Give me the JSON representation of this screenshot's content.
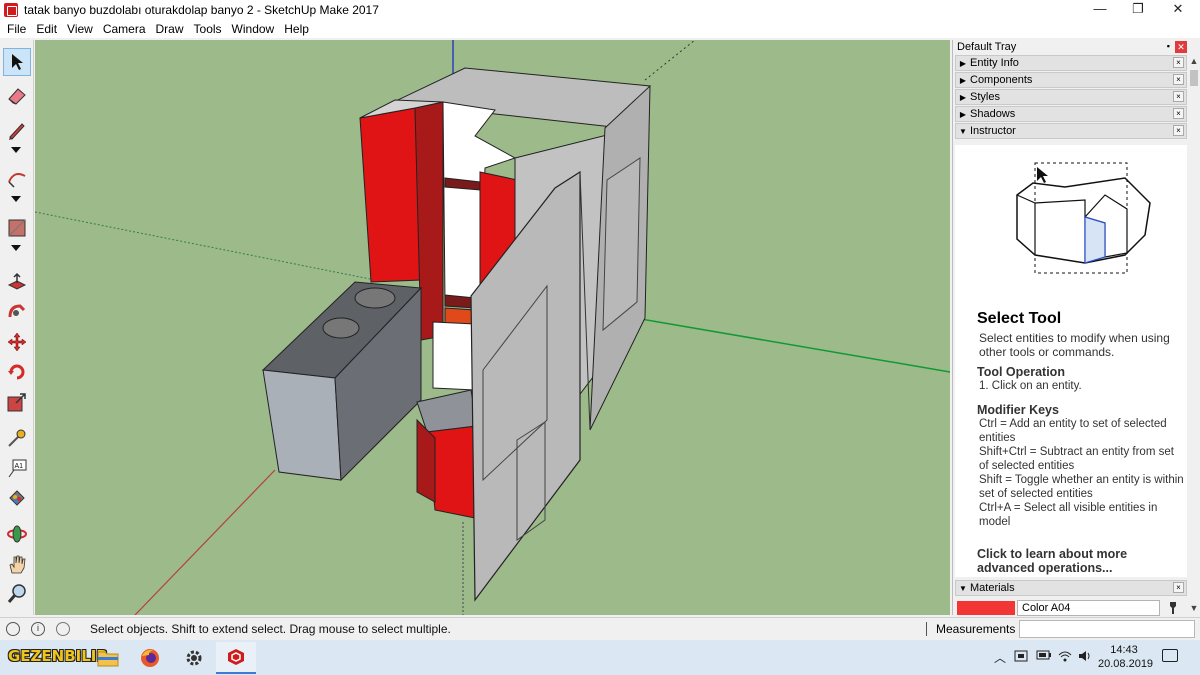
{
  "window": {
    "title": "tatak banyo buzdolabı oturakdolap banyo 2 - SketchUp Make 2017",
    "minimize": "—",
    "maximize": "❐",
    "close": "✕"
  },
  "menu": {
    "items": [
      "File",
      "Edit",
      "View",
      "Camera",
      "Draw",
      "Tools",
      "Window",
      "Help"
    ]
  },
  "toolbar": {
    "tools": [
      "select",
      "eraser",
      "pencil-line",
      "arc",
      "rectangle",
      "push-pull",
      "follow-me",
      "move",
      "rotate",
      "scale",
      "tape-measure",
      "text",
      "paint-bucket",
      "orbit",
      "pan",
      "zoom"
    ],
    "text_tool_label": "A1"
  },
  "tray": {
    "title": "Default Tray",
    "pin": "▪",
    "close": "✕",
    "panels": [
      {
        "label": "Entity Info",
        "expanded": false
      },
      {
        "label": "Components",
        "expanded": false
      },
      {
        "label": "Styles",
        "expanded": false
      },
      {
        "label": "Shadows",
        "expanded": false
      },
      {
        "label": "Instructor",
        "expanded": true
      }
    ],
    "collapsed_marker": "▶",
    "expanded_marker": "▼",
    "panel_close": "×",
    "instructor": {
      "tool_name": "Select Tool",
      "description": "Select entities to modify when using other tools or commands.",
      "operation_heading": "Tool Operation",
      "operation_step": "1. Click on an entity.",
      "modifier_heading": "Modifier Keys",
      "modifiers": [
        "Ctrl = Add an entity to set of selected entities",
        "Shift+Ctrl = Subtract an entity from set of selected entities",
        "Shift = Toggle whether an entity is within set of selected entities",
        "Ctrl+A = Select all visible entities in model"
      ],
      "learn_more": "Click to learn about more advanced operations..."
    },
    "materials": {
      "label": "Materials",
      "color_name": "Color A04",
      "swatch_color": "#f23535"
    }
  },
  "statusbar": {
    "hint": "Select objects. Shift to extend select. Drag mouse to select multiple.",
    "measurements_label": "Measurements",
    "info_icon": "i"
  },
  "taskbar": {
    "logo_text": "GEZENBILIR",
    "clock_time": "14:43",
    "clock_date": "20.08.2019"
  },
  "colors": {
    "viewport_bg": "#9cba8a",
    "red": "#e01414",
    "accent": "#3a7bd5"
  }
}
